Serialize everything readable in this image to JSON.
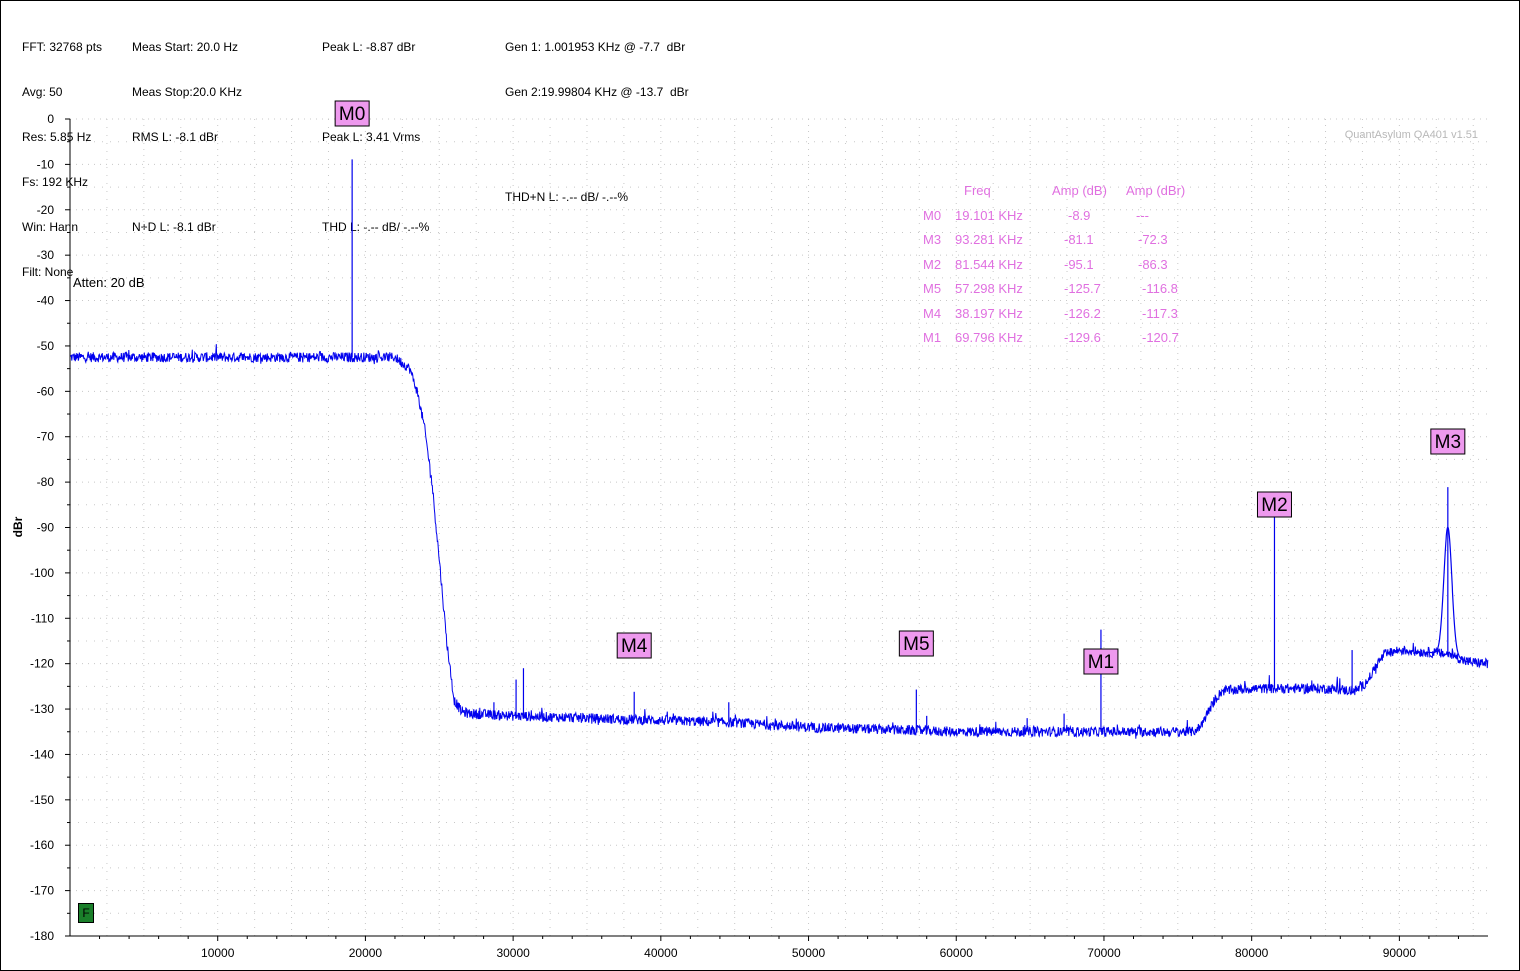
{
  "header": {
    "col1": [
      "FFT: 32768 pts",
      "Avg: 50",
      "Res: 5.85 Hz",
      "Fs: 192 KHz",
      "Win: Hann",
      "Filt: None"
    ],
    "col2": [
      "Meas Start: 20.0 Hz",
      "Meas Stop:20.0 KHz",
      "RMS L: -8.1 dBr",
      "N+D L: -8.1 dBr"
    ],
    "col3": [
      "Peak L: -8.87 dBr",
      "Peak L: 3.41 Vrms",
      "THD L: -.-- dB/ -.--%"
    ],
    "col4": [
      "Gen 1: 1.001953 KHz @ -7.7  dBr",
      "Gen 2:19.99804 KHz @ -13.7  dBr",
      "THD+N L: -.-- dB/ -.--%"
    ]
  },
  "watermark": "QuantAsylum QA401 v1.51",
  "atten": "Atten: 20 dB",
  "f_badge": "F",
  "marker_table": {
    "headers": [
      "Freq",
      "Amp (dB)",
      "Amp (dBr)"
    ],
    "rows": [
      {
        "m": "M0",
        "freq": "19.101 KHz",
        "amp": "-8.9",
        "ampr": "---"
      },
      {
        "m": "M3",
        "freq": "93.281 KHz",
        "amp": "-81.1",
        "ampr": "-72.3"
      },
      {
        "m": "M2",
        "freq": "81.544 KHz",
        "amp": "-95.1",
        "ampr": "-86.3"
      },
      {
        "m": "M5",
        "freq": "57.298 KHz",
        "amp": "-125.7",
        "ampr": "-116.8"
      },
      {
        "m": "M4",
        "freq": "38.197 KHz",
        "amp": "-126.2",
        "ampr": "-117.3"
      },
      {
        "m": "M1",
        "freq": "69.796 KHz",
        "amp": "-129.6",
        "ampr": "-120.7"
      }
    ]
  },
  "colors": {
    "trace": "#0000ee",
    "marker_fill": "#ee99ee",
    "grid": "#c8c8c8",
    "table_text": "#e070e0"
  },
  "chart_data": {
    "type": "line",
    "xlabel": "",
    "ylabel": "dBr",
    "xlim": [
      0,
      96000
    ],
    "ylim": [
      -180,
      0
    ],
    "x_ticks": [
      10000,
      20000,
      30000,
      40000,
      50000,
      60000,
      70000,
      80000,
      90000
    ],
    "y_ticks": [
      0,
      -10,
      -20,
      -30,
      -40,
      -50,
      -60,
      -70,
      -80,
      -90,
      -100,
      -110,
      -120,
      -130,
      -140,
      -150,
      -160,
      -170,
      -180
    ],
    "grid": true,
    "series": [
      {
        "x": [
          20,
          5000,
          10000,
          15000,
          19000,
          22000,
          23000,
          23500,
          24000,
          24500,
          25000,
          25500,
          26000,
          26500,
          27000,
          30000,
          35000,
          40000,
          45000,
          50000,
          55000,
          60000,
          65000,
          70000,
          76000,
          76500,
          77000,
          77500,
          78000,
          80000,
          85000,
          87000,
          87500,
          88000,
          88500,
          89000,
          90000,
          92000,
          93500,
          94500,
          96000
        ],
        "y": [
          -52.5,
          -52.5,
          -52.5,
          -52.5,
          -52.5,
          -52.5,
          -55,
          -60,
          -68,
          -80,
          -97,
          -115,
          -128,
          -130.5,
          -131,
          -131.5,
          -132,
          -132.5,
          -133,
          -134,
          -134.5,
          -135,
          -135,
          -135,
          -135,
          -134,
          -131,
          -128,
          -126,
          -125.5,
          -125.5,
          -126,
          -125,
          -123,
          -120,
          -118,
          -117,
          -117.5,
          -118,
          -119.5,
          -120
        ]
      }
    ],
    "spikes": [
      {
        "x": 19101,
        "y": -8.9
      },
      {
        "x": 38197,
        "y": -126.2
      },
      {
        "x": 57298,
        "y": -125.7
      },
      {
        "x": 69796,
        "y": -112.5
      },
      {
        "x": 81544,
        "y": -87.5
      },
      {
        "x": 93281,
        "y": -81.1
      },
      {
        "x": 30200,
        "y": -123.5
      },
      {
        "x": 30700,
        "y": -121
      },
      {
        "x": 28700,
        "y": -128.5
      },
      {
        "x": 44600,
        "y": -128.5
      },
      {
        "x": 58000,
        "y": -131.5
      },
      {
        "x": 64800,
        "y": -132
      },
      {
        "x": 67300,
        "y": -131
      },
      {
        "x": 86800,
        "y": -117
      }
    ],
    "markers": [
      {
        "label": "M0",
        "x": 19101,
        "y": -8.9
      },
      {
        "label": "M3",
        "x": 93281,
        "y": -81.1
      },
      {
        "label": "M2",
        "x": 81544,
        "y": -95.1
      },
      {
        "label": "M5",
        "x": 57298,
        "y": -125.7
      },
      {
        "label": "M4",
        "x": 38197,
        "y": -126.2
      },
      {
        "label": "M1",
        "x": 69796,
        "y": -129.6
      }
    ]
  }
}
